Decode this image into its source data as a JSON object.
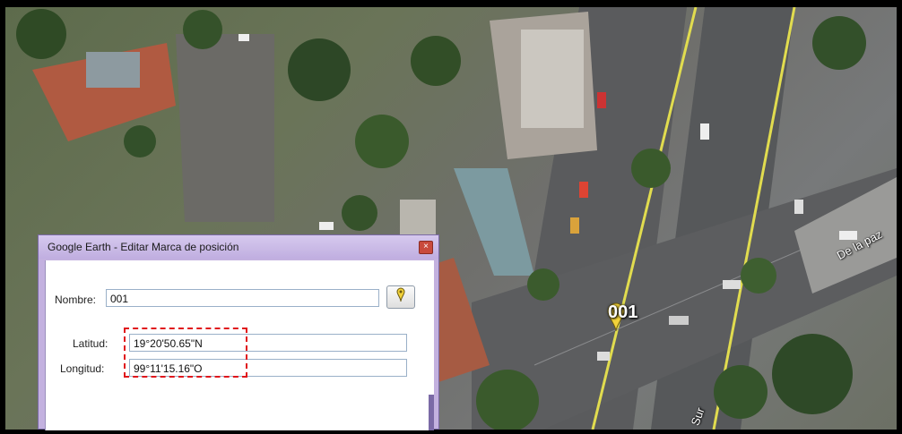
{
  "map": {
    "placemark_label": "001",
    "road_label": "De la paz",
    "road_label_2": "Sur"
  },
  "dialog": {
    "title": "Google Earth - Editar Marca de posición",
    "close_glyph": "×",
    "name_label": "Nombre:",
    "name_value": "001",
    "lat_label": "Latitud:",
    "lat_value": "19°20'50.65\"N",
    "lon_label": "Longitud:",
    "lon_value": "99°11'15.16\"O"
  },
  "colors": {
    "highlight": "#e0161b",
    "pin": "#f2d23a"
  }
}
